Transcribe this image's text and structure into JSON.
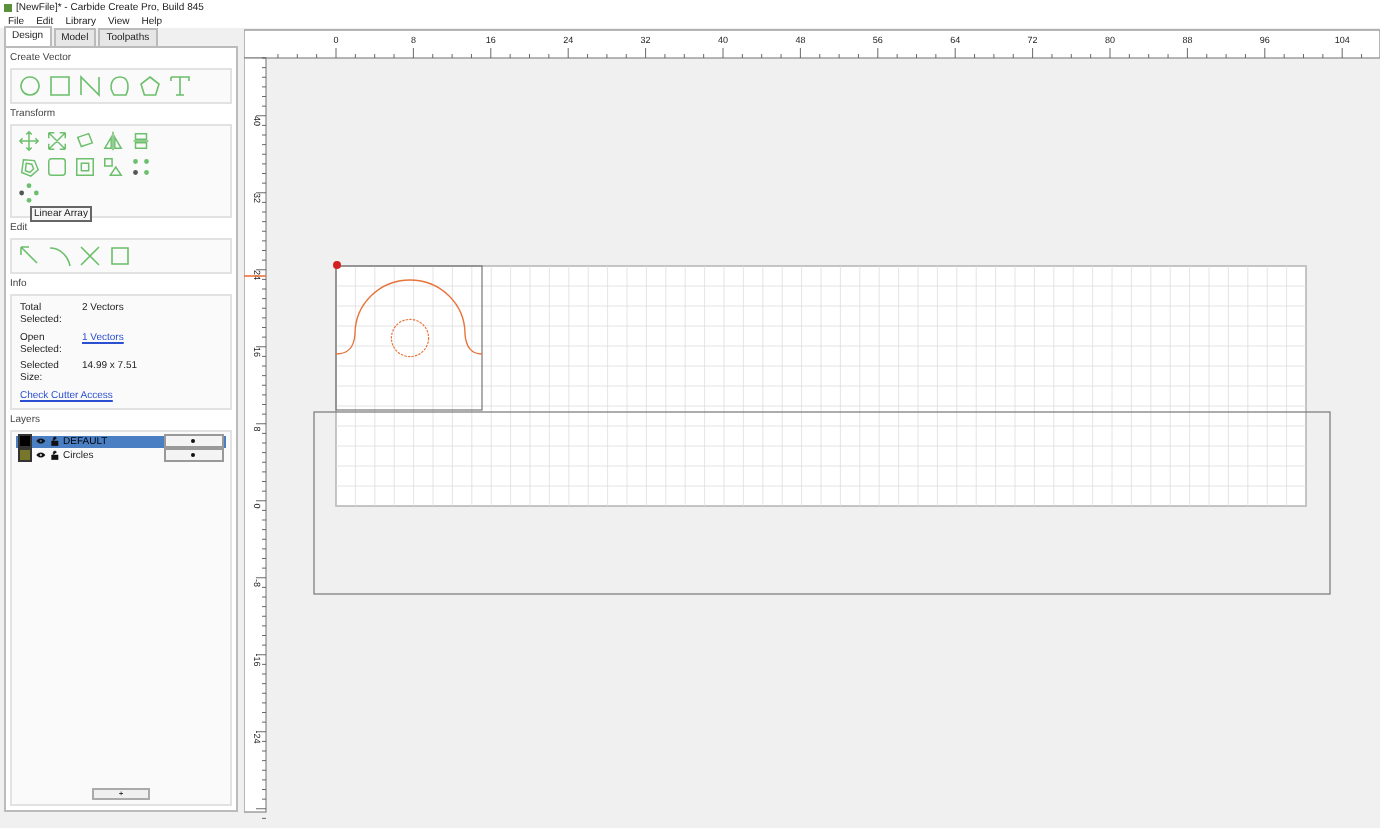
{
  "window": {
    "title": "[NewFile]* - Carbide Create Pro, Build 845"
  },
  "menu": [
    "File",
    "Edit",
    "Library",
    "View",
    "Help"
  ],
  "tabs": [
    {
      "label": "Design",
      "selected": true
    },
    {
      "label": "Model",
      "selected": false
    },
    {
      "label": "Toolpaths",
      "selected": false
    }
  ],
  "sections": {
    "create_vector": "Create Vector",
    "transform": "Transform",
    "edit": "Edit",
    "info": "Info",
    "layers": "Layers"
  },
  "tooltip": "Linear Array",
  "info": {
    "rows": [
      {
        "label": "Total Selected:",
        "value": "2 Vectors",
        "kind": "text"
      },
      {
        "label": "Open Selected:",
        "value": "1 Vectors",
        "kind": "link"
      },
      {
        "label": "Selected Size:",
        "value": "14.99 x 7.51",
        "kind": "text"
      }
    ],
    "link": "Check Cutter Access"
  },
  "layers": [
    {
      "name": "DEFAULT",
      "color": "#000000",
      "selected": true
    },
    {
      "name": "Circles",
      "color": "#77772a",
      "selected": false
    }
  ],
  "add_layer_button": "+",
  "ruler": {
    "x_labels": [
      "0",
      "8",
      "16",
      "24",
      "32",
      "40",
      "48",
      "56",
      "64",
      "72",
      "80",
      "88",
      "96",
      "104"
    ],
    "y_labels": [
      "40",
      "32",
      "24",
      "16",
      "8",
      "0",
      "-8",
      "-16",
      "-24"
    ]
  }
}
